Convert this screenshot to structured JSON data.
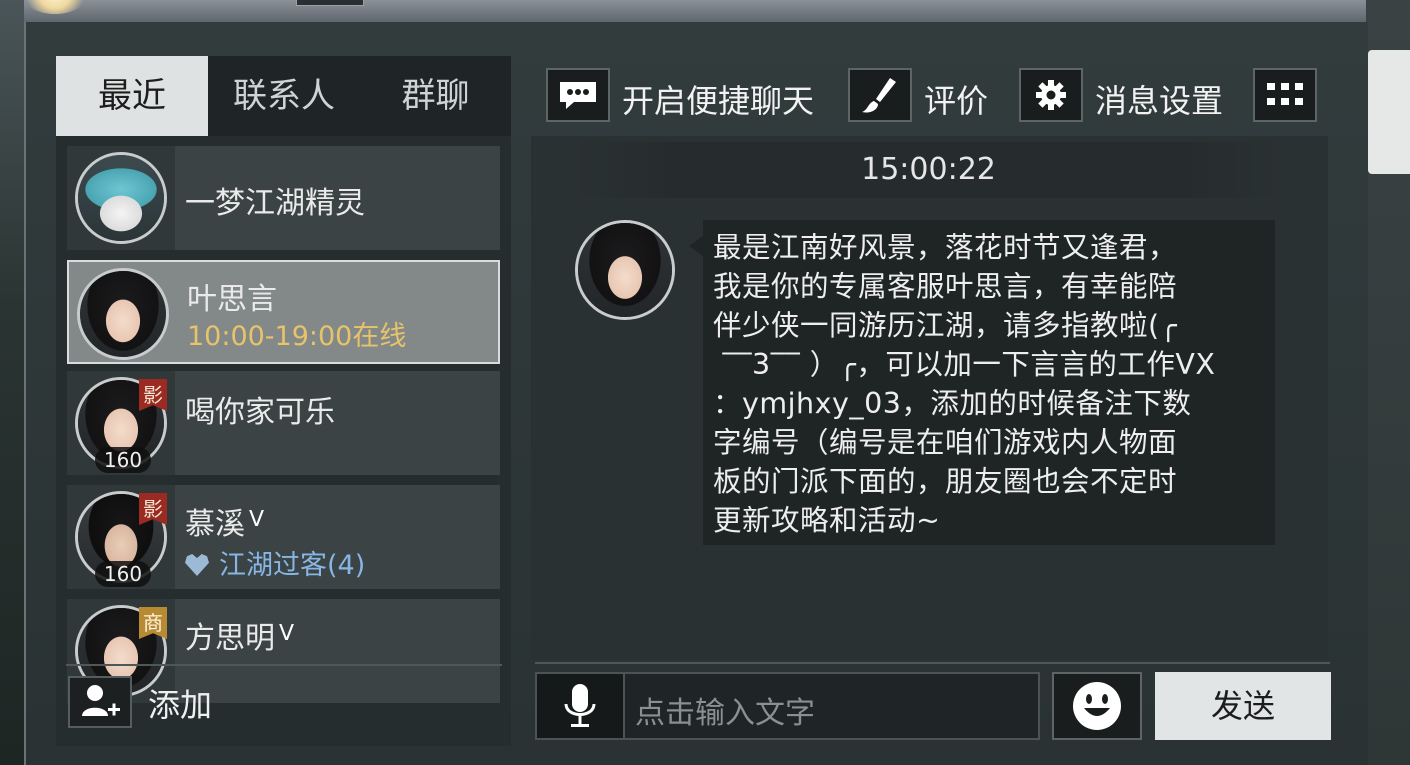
{
  "tabs": [
    "最近",
    "联系人",
    "群聊"
  ],
  "contacts": [
    {
      "name": "一梦江湖精灵",
      "sub": "",
      "badge": "",
      "level": ""
    },
    {
      "name": "叶思言",
      "sub": "10:00-19:00在线",
      "badge": "",
      "level": ""
    },
    {
      "name": "喝你家可乐",
      "sub": "",
      "badge": "影",
      "level": "160"
    },
    {
      "name": "慕溪",
      "v_mark": "ᐯ",
      "sub": "江湖过客(4)",
      "badge": "影",
      "level": "160"
    },
    {
      "name": "方思明",
      "v_mark": "ᐯ",
      "sub": "",
      "badge": "商",
      "level": ""
    }
  ],
  "left_footer": {
    "add_label": "添加"
  },
  "toolbar": {
    "quick_chat_label": "开启便捷聊天",
    "rate_label": "评价",
    "settings_label": "消息设置"
  },
  "chat": {
    "timestamp": "15:00:22",
    "message": "最是江南好风景，落花时节又逢君，\n我是你的专属客服叶思言，有幸能陪\n伴少侠一同游历江湖，请多指教啦(╭\n ‾‾3‾‾ ）╭，可以加一下言言的工作VX\n：ymjhxy_03，添加的时候备注下数\n字编号（编号是在咱们游戏内人物面\n板的门派下面的，朋友圈也会不定时\n更新攻略和活动~"
  },
  "input": {
    "placeholder": "点击输入文字"
  },
  "send_label": "发送",
  "colors": {
    "online": "#e7c36a",
    "relation": "#87b6e4",
    "badge_red": "#9a2a22",
    "badge_gold": "#b88a33"
  },
  "icons": [
    "chat-bubble-icon",
    "brush-icon",
    "gear-icon",
    "grid-menu-icon",
    "add-user-icon",
    "microphone-icon",
    "smiley-icon",
    "heart-icon"
  ]
}
